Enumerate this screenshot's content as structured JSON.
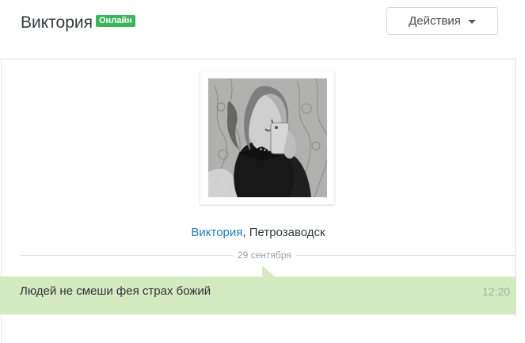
{
  "header": {
    "contact_name": "Виктория",
    "status": "Онлайн",
    "actions_label": "Действия"
  },
  "profile": {
    "name": "Виктория",
    "city_separator": ",",
    "city": "Петрозаводск",
    "photo_alt": "Виктория"
  },
  "timeline": {
    "date": "29 сентября"
  },
  "messages": [
    {
      "text": "Людей не смеши фея страх божий",
      "time": "12:20"
    }
  ],
  "colors": {
    "status_badge": "#3cb45b",
    "profile_link": "#1d7fb7",
    "message_background": "#d4eac0"
  },
  "icons": {
    "actions_dropdown": "chevron-down-icon"
  }
}
